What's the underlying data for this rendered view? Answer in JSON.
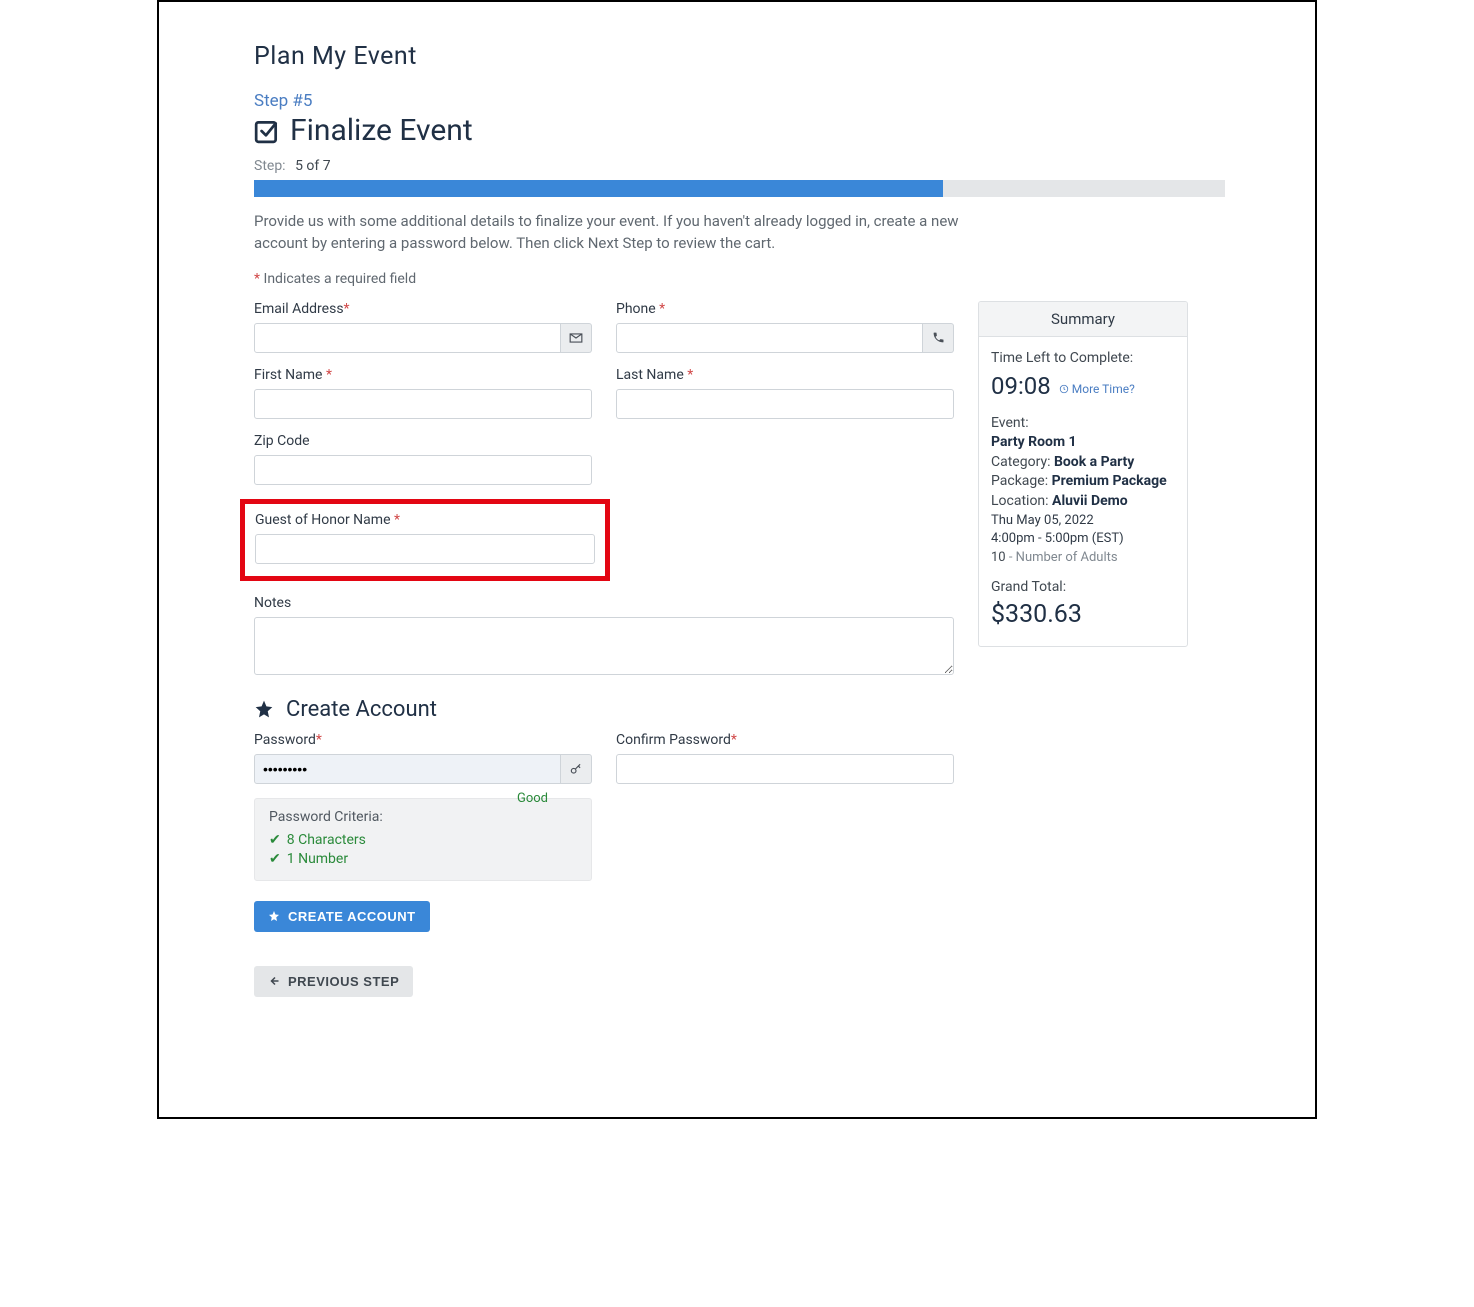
{
  "pageTitle": "Plan My Event",
  "stepLabel": "Step #5",
  "stepHeading": "Finalize Event",
  "stepIndicatorLabel": "Step:",
  "stepIndicatorValue": "5 of 7",
  "progressPercent": 71,
  "introText": "Provide us with some additional details to finalize your event. If you haven't already logged in, create a new account by entering a password below. Then click Next Step to review the cart.",
  "requiredNote": "Indicates a required field",
  "fields": {
    "email": {
      "label": "Email Address",
      "required": true,
      "value": ""
    },
    "phone": {
      "label": "Phone",
      "required": true,
      "value": ""
    },
    "firstName": {
      "label": "First Name",
      "required": true,
      "value": ""
    },
    "lastName": {
      "label": "Last Name",
      "required": true,
      "value": ""
    },
    "zipCode": {
      "label": "Zip Code",
      "required": false,
      "value": ""
    },
    "guestOfHonor": {
      "label": "Guest of Honor Name",
      "required": true,
      "value": ""
    },
    "notes": {
      "label": "Notes",
      "required": false,
      "value": ""
    },
    "password": {
      "label": "Password",
      "required": true,
      "value": "•••••••••",
      "strength": "Good"
    },
    "confirmPassword": {
      "label": "Confirm Password",
      "required": true,
      "value": ""
    }
  },
  "createAccount": {
    "title": "Create Account",
    "criteriaTitle": "Password Criteria:",
    "criteria": [
      "8 Characters",
      "1 Number"
    ],
    "buttonLabel": "CREATE ACCOUNT"
  },
  "previousButton": "PREVIOUS STEP",
  "summary": {
    "title": "Summary",
    "timeLeftLabel": "Time Left to Complete:",
    "timeLeft": "09:08",
    "moreTime": "More Time?",
    "eventLabel": "Event:",
    "eventName": "Party Room 1",
    "categoryLabel": "Category:",
    "categoryValue": "Book a Party",
    "packageLabel": "Package:",
    "packageValue": "Premium Package",
    "locationLabel": "Location:",
    "locationValue": "Aluvii Demo",
    "dateLine": "Thu May 05, 2022",
    "timeLine": "4:00pm - 5:00pm (EST)",
    "adultsCount": "10",
    "adultsLabel": " - Number of Adults",
    "grandLabel": "Grand Total:",
    "grandTotal": "$330.63"
  }
}
